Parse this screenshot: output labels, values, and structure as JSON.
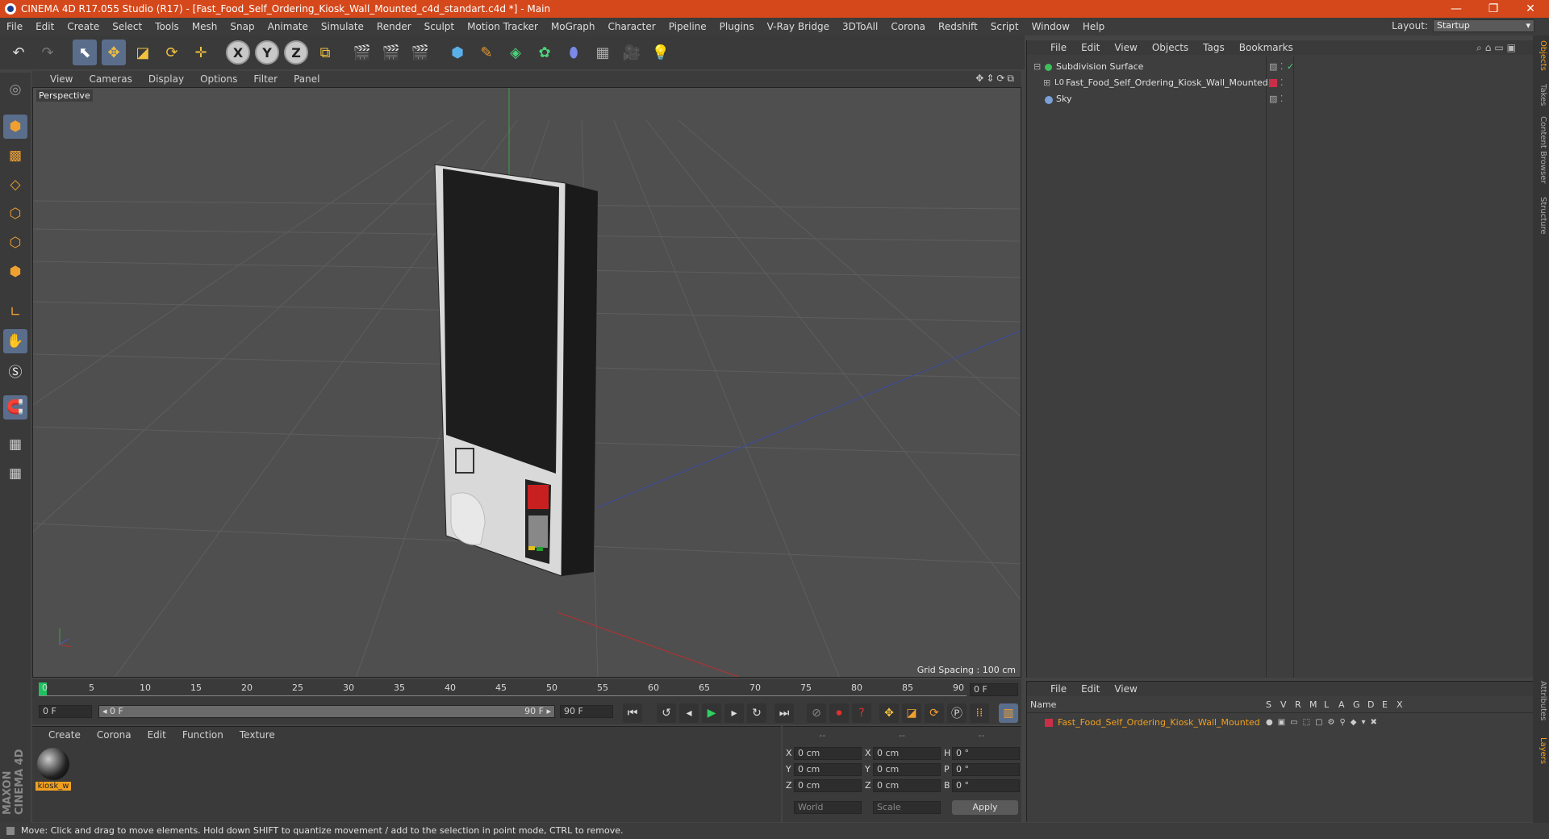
{
  "window": {
    "title": "CINEMA 4D R17.055 Studio (R17) - [Fast_Food_Self_Ordering_Kiosk_Wall_Mounted_c4d_standart.c4d *] - Main",
    "min": "—",
    "restore": "❐",
    "close": "✕"
  },
  "menu": {
    "items": [
      "File",
      "Edit",
      "Create",
      "Select",
      "Tools",
      "Mesh",
      "Snap",
      "Animate",
      "Simulate",
      "Render",
      "Sculpt",
      "Motion Tracker",
      "MoGraph",
      "Character",
      "Pipeline",
      "Plugins",
      "V-Ray Bridge",
      "3DToAll",
      "Corona",
      "Redshift",
      "Script",
      "Window",
      "Help"
    ],
    "layout_label": "Layout:",
    "layout_value": "Startup"
  },
  "viewport": {
    "menu": [
      "View",
      "Cameras",
      "Display",
      "Options",
      "Filter",
      "Panel"
    ],
    "label": "Perspective",
    "grid_spacing": "Grid Spacing : 100 cm"
  },
  "timeline": {
    "ticks": [
      "0",
      "5",
      "10",
      "15",
      "20",
      "25",
      "30",
      "35",
      "40",
      "45",
      "50",
      "55",
      "60",
      "65",
      "70",
      "75",
      "80",
      "85",
      "90"
    ],
    "frame_field": "0 F"
  },
  "controls": {
    "start": "0 F",
    "slider_start": "◂ 0 F",
    "slider_end": "90 F ▸",
    "end": "90 F"
  },
  "materials": {
    "menu": [
      "Create",
      "Corona",
      "Edit",
      "Function",
      "Texture"
    ],
    "items": [
      {
        "name": "kiosk_w"
      }
    ]
  },
  "coords": {
    "header": [
      "--",
      "--",
      "--"
    ],
    "rows": [
      {
        "a": "X",
        "av": "0 cm",
        "b": "X",
        "bv": "0 cm",
        "c": "H",
        "cv": "0 °"
      },
      {
        "a": "Y",
        "av": "0 cm",
        "b": "Y",
        "bv": "0 cm",
        "c": "P",
        "cv": "0 °"
      },
      {
        "a": "Z",
        "av": "0 cm",
        "b": "Z",
        "bv": "0 cm",
        "c": "B",
        "cv": "0 °"
      }
    ],
    "world": "World",
    "scale": "Scale",
    "apply": "Apply"
  },
  "objects": {
    "menu": [
      "File",
      "Edit",
      "View",
      "Objects",
      "Tags",
      "Bookmarks"
    ],
    "items": [
      {
        "name": "Subdivision Surface",
        "color": "#3fbf5a"
      },
      {
        "name": "Fast_Food_Self_Ordering_Kiosk_Wall_Mounted",
        "color": "#c0c0c0"
      },
      {
        "name": "Sky",
        "color": "#7aa0d8"
      }
    ]
  },
  "layers": {
    "menu": [
      "File",
      "Edit",
      "View"
    ],
    "header": {
      "name": "Name",
      "cols": [
        "S",
        "V",
        "R",
        "M",
        "L",
        "A",
        "G",
        "D",
        "E",
        "X"
      ]
    },
    "items": [
      {
        "name": "Fast_Food_Self_Ordering_Kiosk_Wall_Mounted",
        "color": "#c8304a"
      }
    ]
  },
  "side_tabs": [
    "Objects",
    "Takes",
    "Content Browser",
    "Structure",
    "Attributes",
    "Layers"
  ],
  "status": "Move: Click and drag to move elements. Hold down SHIFT to quantize movement / add to the selection in point mode, CTRL to remove.",
  "brand": "MAXON CINEMA 4D",
  "accent": "#d4481b"
}
